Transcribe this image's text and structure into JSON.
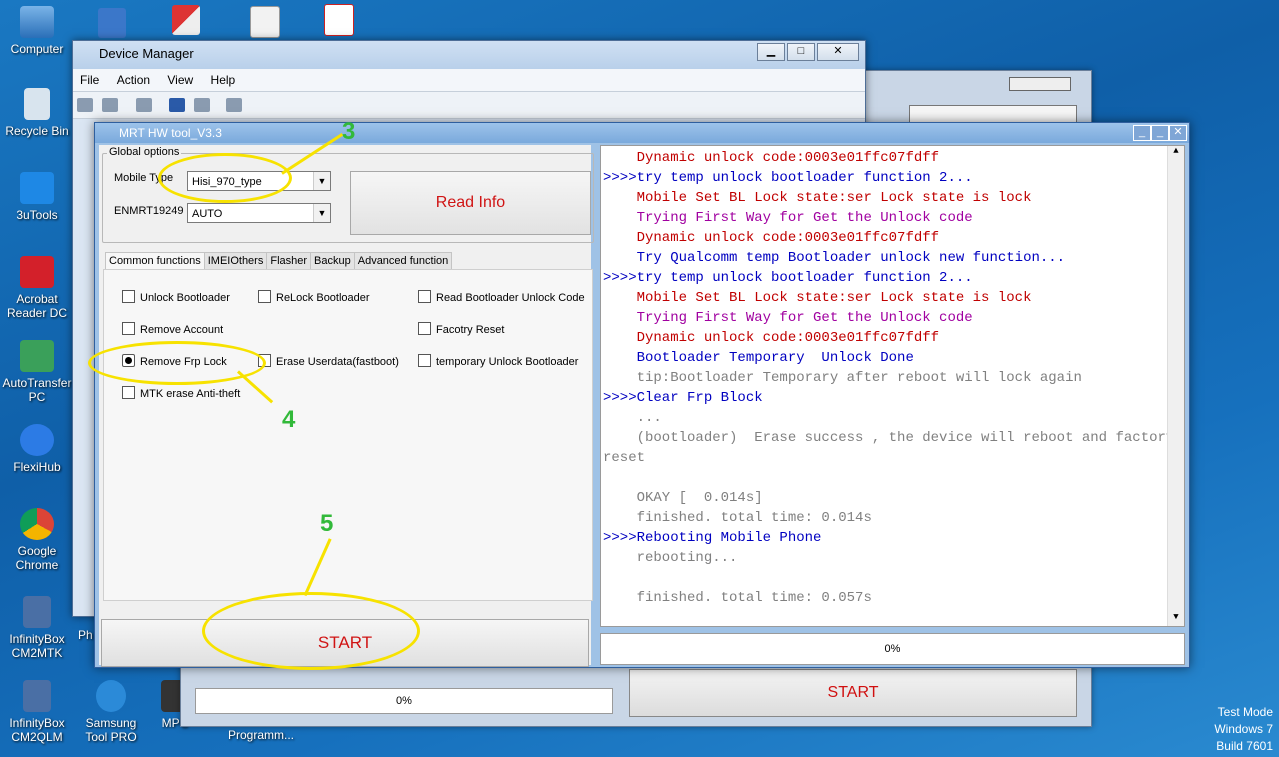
{
  "desktop": {
    "icons": [
      {
        "label": "Computer"
      },
      {
        "label": "Recycle Bin"
      },
      {
        "label": "3uTools"
      },
      {
        "label": "Acrobat Reader DC"
      },
      {
        "label": "AutoTransfer PC"
      },
      {
        "label": "FlexiHub"
      },
      {
        "label": "Google Chrome"
      },
      {
        "label": "InfinityBox CM2MTK"
      },
      {
        "label": "InfinityBox CM2QLM"
      },
      {
        "label": "Samsung Tool PRO"
      },
      {
        "label": "MPC"
      },
      {
        "label": "Ph"
      },
      {
        "label": "Programm..."
      }
    ],
    "watermark": {
      "line1": "Test Mode",
      "line2": "Windows 7",
      "line3": "Build 7601"
    }
  },
  "device_manager": {
    "title": "Device Manager",
    "menu": [
      "File",
      "Action",
      "View",
      "Help"
    ]
  },
  "background_window": {
    "start_label": "START",
    "progress": "0%"
  },
  "mrt": {
    "title": "MRT HW tool_V3.3",
    "global_options_label": "Global options",
    "mobile_type_label": "Mobile Type",
    "mobile_type_value": "Hisi_970_type",
    "port_label": "ENMRT19249",
    "port_value": "AUTO",
    "read_info_label": "Read Info",
    "tabs": [
      "Common functions",
      "IMEIOthers",
      "Flasher",
      "Backup",
      "Advanced function"
    ],
    "options": [
      {
        "label": "Unlock Bootloader",
        "checked": false
      },
      {
        "label": "ReLock Bootloader",
        "checked": false
      },
      {
        "label": "Read Bootloader Unlock Code",
        "checked": false
      },
      {
        "label": "Remove Account",
        "checked": false
      },
      {
        "label": "Facotry Reset",
        "checked": false
      },
      {
        "label": "Remove Frp Lock",
        "checked": true
      },
      {
        "label": "Erase Userdata(fastboot)",
        "checked": false
      },
      {
        "label": "temporary Unlock Bootloader",
        "checked": false
      },
      {
        "label": "MTK erase Anti-theft",
        "checked": false
      }
    ],
    "start_label": "START",
    "progress": "0%",
    "log": [
      {
        "text": "    Dynamic unlock code:0003e01ffc07fdff",
        "color": "#c00000"
      },
      {
        "text": ">>>>try temp unlock bootloader function 2...",
        "color": "#0000c0"
      },
      {
        "text": "    Mobile Set BL Lock state:ser Lock state is lock",
        "color": "#c00000"
      },
      {
        "text": "    Trying First Way for Get the Unlock code",
        "color": "#a000a0"
      },
      {
        "text": "    Dynamic unlock code:0003e01ffc07fdff",
        "color": "#c00000"
      },
      {
        "text": "    Try Qualcomm temp Bootloader unlock new function...",
        "color": "#0000c0"
      },
      {
        "text": ">>>>try temp unlock bootloader function 2...",
        "color": "#0000c0"
      },
      {
        "text": "    Mobile Set BL Lock state:ser Lock state is lock",
        "color": "#c00000"
      },
      {
        "text": "    Trying First Way for Get the Unlock code",
        "color": "#a000a0"
      },
      {
        "text": "    Dynamic unlock code:0003e01ffc07fdff",
        "color": "#c00000"
      },
      {
        "text": "    Bootloader Temporary  Unlock Done",
        "color": "#0000c0"
      },
      {
        "text": "    tip:Bootloader Temporary after reboot will lock again",
        "color": "#808080"
      },
      {
        "text": ">>>>Clear Frp Block",
        "color": "#0000c0"
      },
      {
        "text": "    ...",
        "color": "#808080"
      },
      {
        "text": "    (bootloader)  Erase success , the device will reboot and factory",
        "color": "#808080"
      },
      {
        "text": "reset",
        "color": "#808080"
      },
      {
        "text": "",
        "color": "#808080"
      },
      {
        "text": "    OKAY [  0.014s]",
        "color": "#808080"
      },
      {
        "text": "    finished. total time: 0.014s",
        "color": "#808080"
      },
      {
        "text": ">>>>Rebooting Mobile Phone",
        "color": "#0000c0"
      },
      {
        "text": "    rebooting...",
        "color": "#808080"
      },
      {
        "text": "",
        "color": "#808080"
      },
      {
        "text": "    finished. total time: 0.057s",
        "color": "#808080"
      }
    ]
  },
  "annotations": {
    "n3": "3",
    "n4": "4",
    "n5": "5"
  }
}
